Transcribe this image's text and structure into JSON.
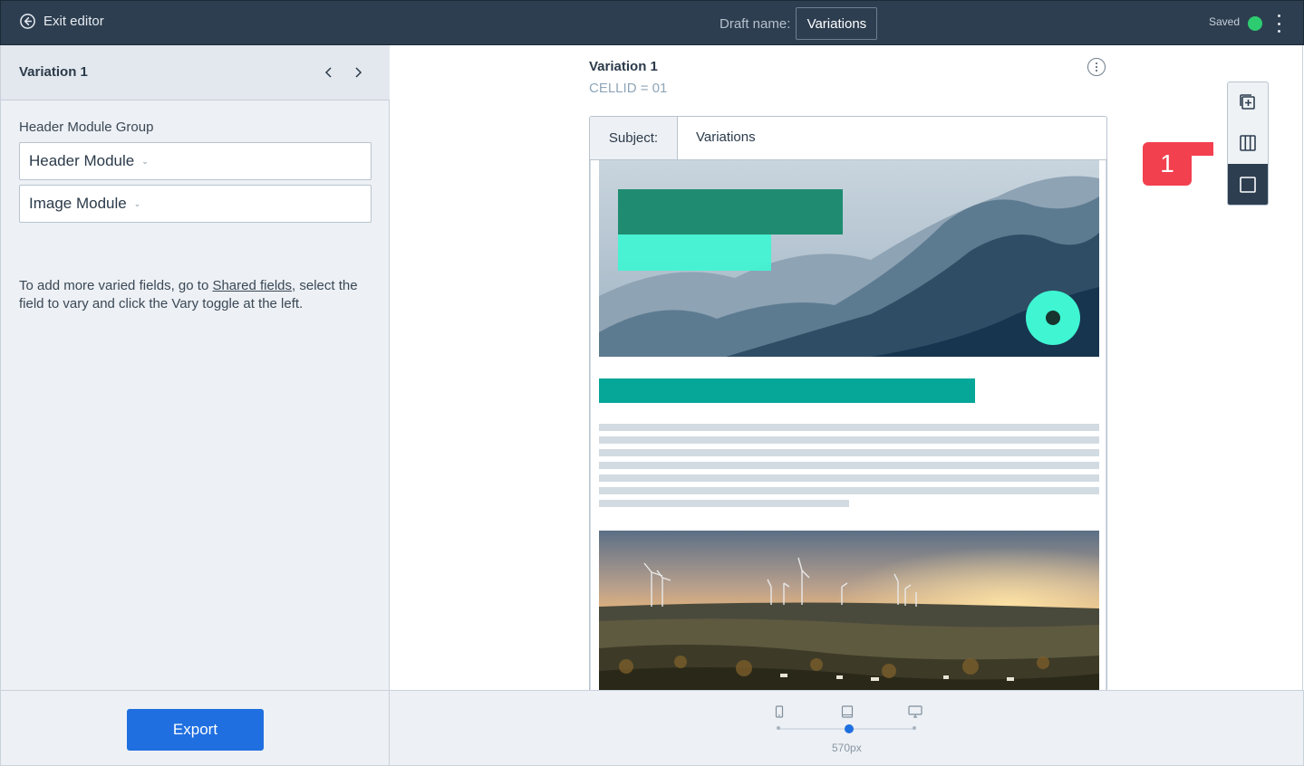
{
  "topbar": {
    "exit_label": "Exit editor",
    "draft_label": "Draft name:",
    "draft_value": "Variations",
    "status_label": "Saved",
    "status_color": "#2ecc71"
  },
  "sidebar": {
    "variation_title": "Variation 1",
    "group_label": "Header Module Group",
    "modules": [
      {
        "label": "Header Module"
      },
      {
        "label": "Image Module"
      }
    ],
    "hint_before": "To add more varied fields, go to ",
    "hint_link": "Shared fields",
    "hint_after": ", select the field to vary and click the Vary toggle at the left.",
    "export_label": "Export"
  },
  "canvas": {
    "variation_title": "Variation 1",
    "cell_id": "CELLID = 01",
    "subject_label": "Subject:",
    "subject_value": "Variations"
  },
  "toolbar": {
    "tools": [
      "add-block-icon",
      "columns-icon",
      "single-column-icon"
    ],
    "active_tool": "single-column-icon",
    "badge_label": "1"
  },
  "preview": {
    "devices": [
      "mobile-icon",
      "tablet-icon",
      "desktop-icon"
    ],
    "active_device": "tablet-icon",
    "width_label": "570px"
  },
  "colors": {
    "topbar": "#2d3e50",
    "accent": "#1f6fe0",
    "teal": "#06a799",
    "badge": "#f2404f"
  }
}
